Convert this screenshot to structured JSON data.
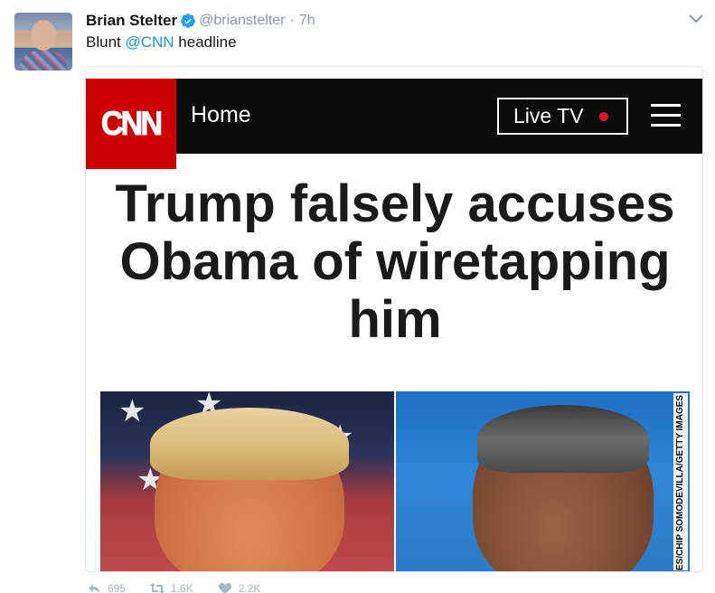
{
  "tweet": {
    "author_name": "Brian Stelter",
    "handle": "@brianstelter",
    "separator": "·",
    "timestamp": "7h",
    "text_prefix": "Blunt ",
    "mention": "@CNN",
    "text_suffix": " headline",
    "verified_color": "#1da1f2"
  },
  "card": {
    "logo_text": "CNN",
    "nav_home": "Home",
    "live_tv_label": "Live TV",
    "live_dot_color": "#e0141c",
    "brand_color": "#cc0000",
    "headline_lines": [
      "Trump falsely accuses",
      "Obama of wiretapping",
      "him"
    ],
    "photo_credit": "ES/CHIP SOMODEVILLA/GETTY IMAGES"
  },
  "actions": {
    "reply_count": "695",
    "retweet_count": "1.6K",
    "like_count": "2.2K"
  },
  "icons": [
    "verified-badge-icon",
    "chevron-down-icon",
    "menu-icon",
    "reply-icon",
    "retweet-icon",
    "like-icon"
  ]
}
